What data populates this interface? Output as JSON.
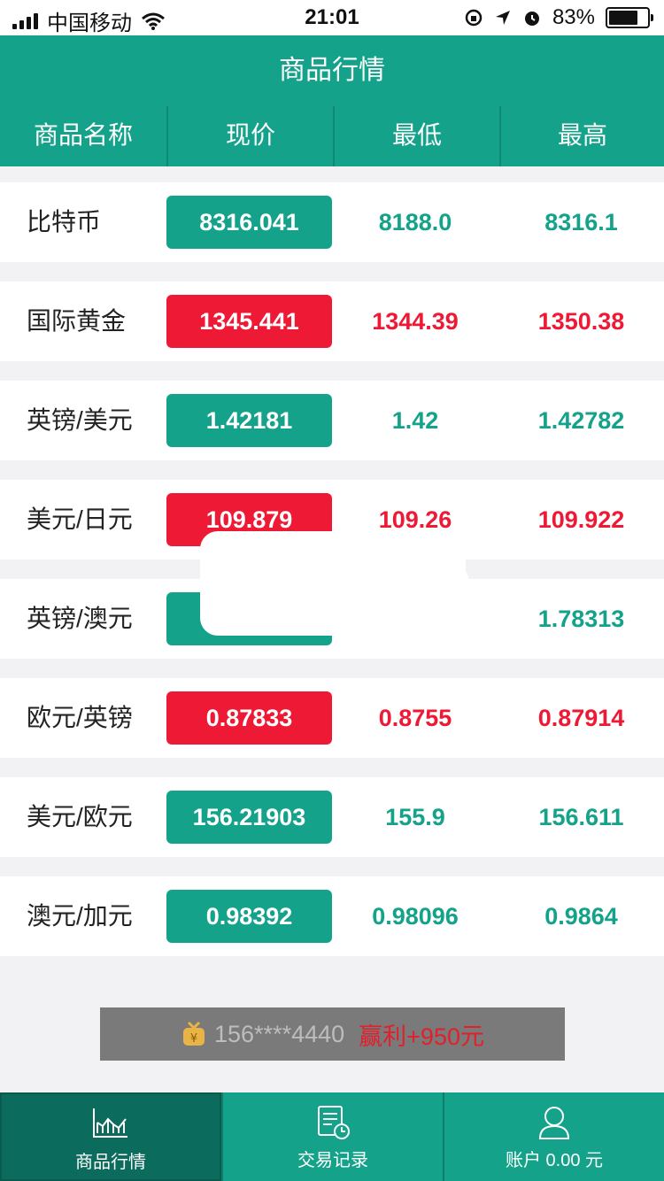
{
  "status_bar": {
    "carrier": "中国移动",
    "time": "21:01",
    "battery": "83%",
    "battery_level": 0.83
  },
  "nav": {
    "title": "商品行情"
  },
  "table": {
    "columns": [
      "商品名称",
      "现价",
      "最低",
      "最高"
    ],
    "rows": [
      {
        "name": "比特币",
        "price": "8316.041",
        "low": "8188.0",
        "high": "8316.1",
        "trend": "up"
      },
      {
        "name": "国际黄金",
        "price": "1345.441",
        "low": "1344.39",
        "high": "1350.38",
        "trend": "down"
      },
      {
        "name": "英镑/美元",
        "price": "1.42181",
        "low": "1.42",
        "high": "1.42782",
        "trend": "up"
      },
      {
        "name": "美元/日元",
        "price": "109.879",
        "low": "109.26",
        "high": "109.922",
        "trend": "down"
      },
      {
        "name": "英镑/澳元",
        "price": "",
        "low": "",
        "high": "1.78313",
        "trend": "up"
      },
      {
        "name": "欧元/英镑",
        "price": "0.87833",
        "low": "0.8755",
        "high": "0.87914",
        "trend": "down"
      },
      {
        "name": "美元/欧元",
        "price": "156.21903",
        "low": "155.9",
        "high": "156.611",
        "trend": "up"
      },
      {
        "name": "澳元/加元",
        "price": "0.98392",
        "low": "0.98096",
        "high": "0.9864",
        "trend": "up"
      }
    ]
  },
  "ticker": {
    "user": "156****4440",
    "result": "赢利+950元"
  },
  "tabbar": {
    "tabs": [
      {
        "label": "商品行情",
        "icon": "chart-icon"
      },
      {
        "label": "交易记录",
        "icon": "document-clock-icon"
      },
      {
        "label": "账户 0.00 元",
        "icon": "user-icon"
      }
    ]
  },
  "colors": {
    "primary": "#14a38a",
    "up": "#14a38a",
    "down": "#ee1a35"
  }
}
